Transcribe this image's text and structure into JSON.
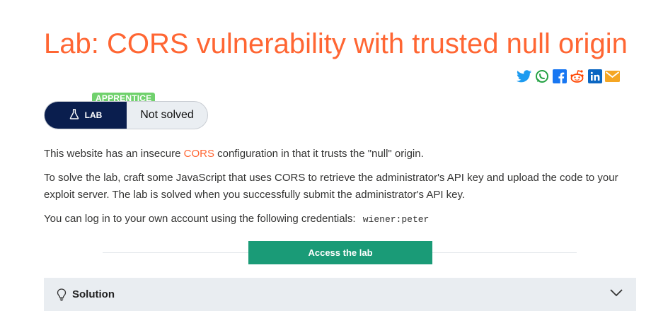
{
  "page": {
    "title": "Lab: CORS vulnerability with trusted null origin"
  },
  "share": {
    "icons": [
      "twitter-icon",
      "whatsapp-icon",
      "facebook-icon",
      "reddit-icon",
      "linkedin-icon",
      "email-icon"
    ]
  },
  "lab": {
    "level": "APPRENTICE",
    "badge_label": "LAB",
    "status": "Not solved"
  },
  "description": {
    "p1_before": "This website has an insecure ",
    "p1_link": "CORS",
    "p1_after": " configuration in that it trusts the \"null\" origin.",
    "p2": "To solve the lab, craft some JavaScript that uses CORS to retrieve the administrator's API key and upload the code to your exploit server. The lab is solved when you successfully submit the administrator's API key.",
    "p3": "You can log in to your own account using the following credentials:",
    "credentials": "wiener:peter"
  },
  "actions": {
    "access_label": "Access the lab"
  },
  "solution": {
    "label": "Solution"
  },
  "colors": {
    "accent": "#ff6633",
    "lab_badge": "#0a1e4e",
    "level_badge": "#70d16d",
    "access_button": "#1a9b77"
  }
}
